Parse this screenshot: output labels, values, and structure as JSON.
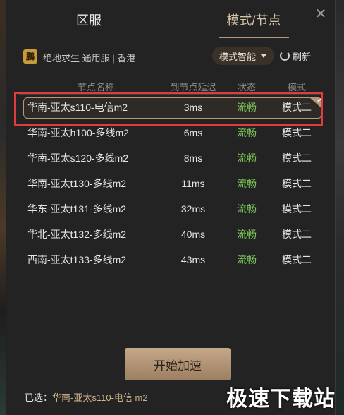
{
  "tabs": {
    "region_label": "区服",
    "mode_label": "模式/节点"
  },
  "game": {
    "icon_glyph": "鵬",
    "label": "绝地求生 通用服 | 香港"
  },
  "mode_select": {
    "value": "模式智能"
  },
  "refresh_label": "刷新",
  "table": {
    "headers": {
      "name": "节点名称",
      "delay": "到节点延迟",
      "status": "状态",
      "mode": "模式"
    },
    "rows": [
      {
        "name": "华南-亚太s110-电信m2",
        "delay": "3ms",
        "status": "流畅",
        "mode": "模式二"
      },
      {
        "name": "华南-亚太h100-多线m2",
        "delay": "6ms",
        "status": "流畅",
        "mode": "模式二"
      },
      {
        "name": "华南-亚太s120-多线m2",
        "delay": "8ms",
        "status": "流畅",
        "mode": "模式二"
      },
      {
        "name": "华南-亚太t130-多线m2",
        "delay": "11ms",
        "status": "流畅",
        "mode": "模式二"
      },
      {
        "name": "华东-亚太t131-多线m2",
        "delay": "32ms",
        "status": "流畅",
        "mode": "模式二"
      },
      {
        "name": "华北-亚太t132-多线m2",
        "delay": "40ms",
        "status": "流畅",
        "mode": "模式二"
      },
      {
        "name": "西南-亚太t133-多线m2",
        "delay": "43ms",
        "status": "流畅",
        "mode": "模式二"
      }
    ]
  },
  "start_button": "开始加速",
  "selected": {
    "prefix": "已选：",
    "value": "华南-亚太s110-电信 m2"
  },
  "watermark": "极速下载站",
  "colors": {
    "accent": "#b49a7a",
    "status_good": "#7ec85a",
    "highlight": "#e23b3b"
  }
}
